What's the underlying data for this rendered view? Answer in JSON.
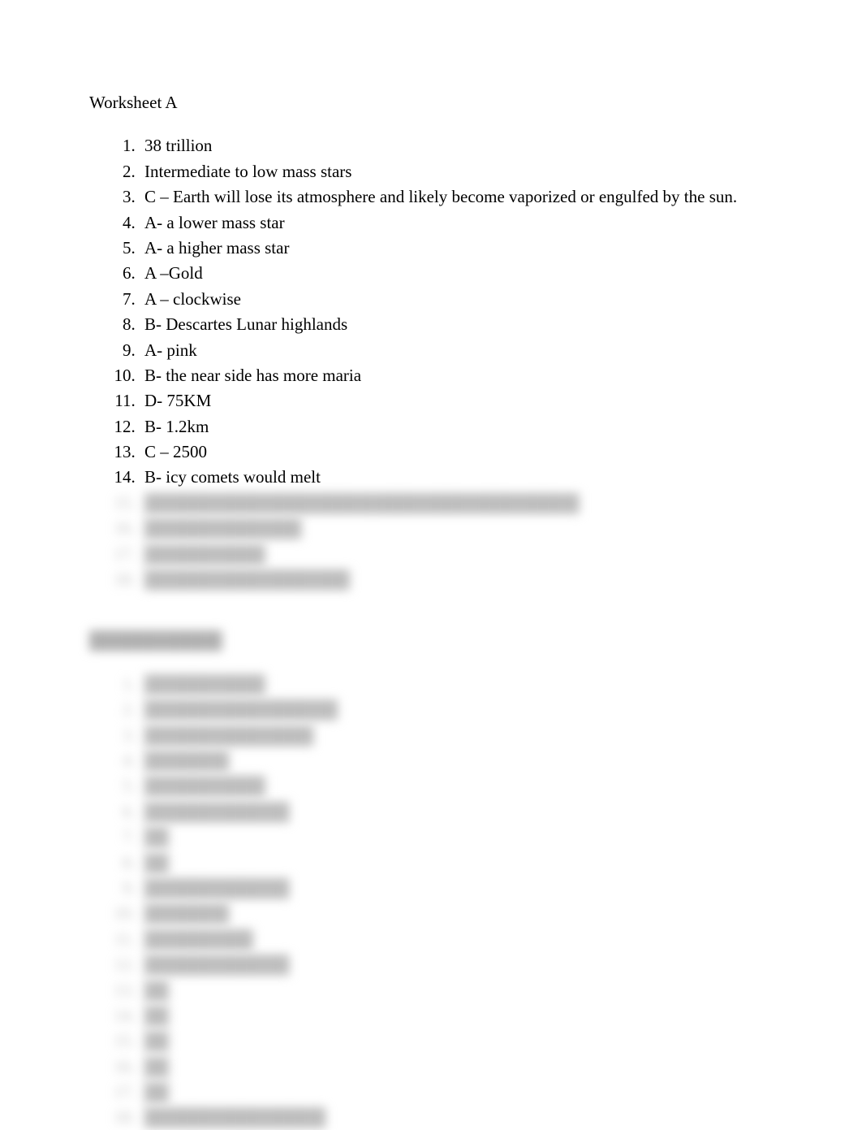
{
  "sectionA": {
    "title": "Worksheet A",
    "items": [
      "38 trillion",
      "Intermediate to low mass stars",
      "C – Earth will lose its atmosphere and likely become vaporized or engulfed by the sun.",
      "A- a lower mass star",
      "A- a higher mass star",
      "A –Gold",
      "A – clockwise",
      "B- Descartes Lunar highlands",
      "A- pink",
      "B- the near side has more maria",
      "D- 75KM",
      "B- 1.2km",
      "C – 2500",
      "B- icy comets would melt"
    ],
    "hiddenItems": [
      "████████████████████████████████████",
      "█████████████",
      "██████████",
      "█████████████████"
    ]
  },
  "sectionB": {
    "title": "███████████",
    "hiddenItems": [
      "██████████",
      "████████████████",
      "██████████████",
      "███████",
      "██████████",
      "████████████",
      "██",
      "██",
      "████████████",
      "███████",
      "█████████",
      "████████████",
      "██",
      "██",
      "██",
      "██",
      "██",
      "███████████████"
    ]
  }
}
